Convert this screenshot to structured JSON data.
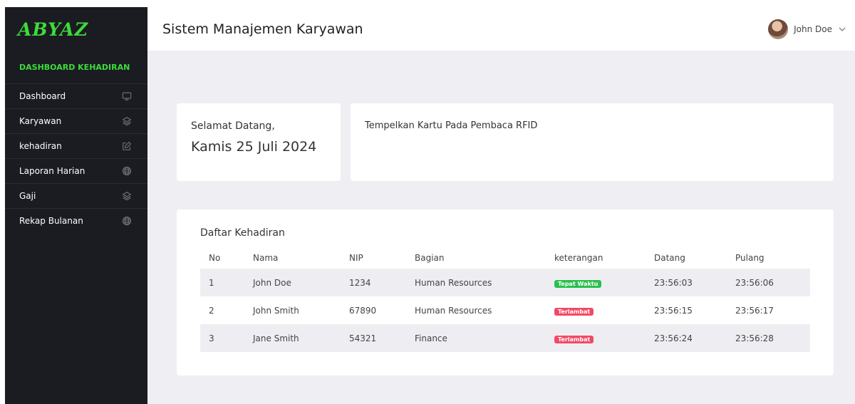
{
  "brand": {
    "logo_text": "ABYAZ",
    "accent": "#3ddc3a"
  },
  "sidebar": {
    "section_title": "DASHBOARD KEHADIRAN",
    "items": [
      {
        "label": "Dashboard",
        "icon": "monitor-icon"
      },
      {
        "label": "Karyawan",
        "icon": "layers-icon"
      },
      {
        "label": "kehadiran",
        "icon": "edit-icon"
      },
      {
        "label": "Laporan Harian",
        "icon": "globe-icon"
      },
      {
        "label": "Gaji",
        "icon": "layers-icon"
      },
      {
        "label": "Rekap Bulanan",
        "icon": "globe-icon"
      }
    ]
  },
  "header": {
    "title": "Sistem Manajemen Karyawan",
    "user_name": "John Doe"
  },
  "welcome": {
    "greeting": "Selamat Datang,",
    "date": "Kamis 25 Juli 2024"
  },
  "rfid": {
    "prompt": "Tempelkan Kartu Pada Pembaca RFID"
  },
  "attendance": {
    "title": "Daftar Kehadiran",
    "columns": [
      "No",
      "Nama",
      "NIP",
      "Bagian",
      "keterangan",
      "Datang",
      "Pulang"
    ],
    "rows": [
      {
        "no": "1",
        "nama": "John Doe",
        "nip": "1234",
        "bagian": "Human Resources",
        "keterangan": "Tepat Waktu",
        "status_color": "#2bbf4e",
        "datang": "23:56:03",
        "pulang": "23:56:06"
      },
      {
        "no": "2",
        "nama": "John Smith",
        "nip": "67890",
        "bagian": "Human Resources",
        "keterangan": "Terlambat",
        "status_color": "#f24a66",
        "datang": "23:56:15",
        "pulang": "23:56:17"
      },
      {
        "no": "3",
        "nama": "Jane Smith",
        "nip": "54321",
        "bagian": "Finance",
        "keterangan": "Terlambat",
        "status_color": "#f24a66",
        "datang": "23:56:24",
        "pulang": "23:56:28"
      }
    ]
  }
}
